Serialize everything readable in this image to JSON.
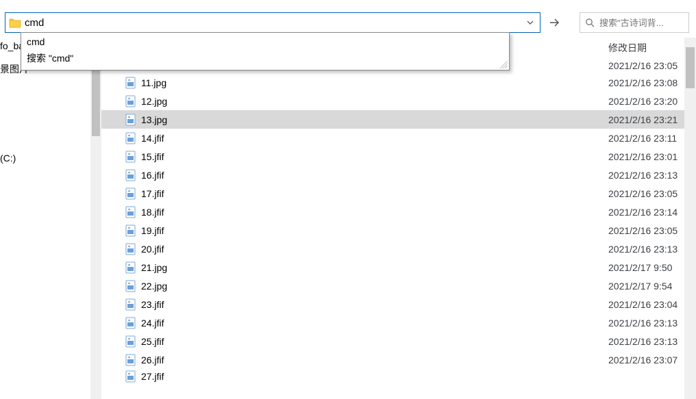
{
  "address": {
    "value": "cmd"
  },
  "dropdown": {
    "items": [
      "cmd",
      "搜索 \"cmd\""
    ]
  },
  "search": {
    "placeholder": "搜索\"古诗词背..."
  },
  "columns": {
    "date": "修改日期"
  },
  "left_nav": {
    "items": [
      "fo_bak",
      "",
      "景图片",
      "",
      "",
      "",
      "",
      "",
      "",
      "",
      "",
      "",
      "",
      "",
      "",
      "",
      "(C:)"
    ]
  },
  "files": [
    {
      "name": "11.jpg",
      "date": "2021/2/16 23:08",
      "selected": false,
      "clipped": false,
      "above_date": "2021/2/16 23:05"
    },
    {
      "name": "12.jpg",
      "date": "2021/2/16 23:20",
      "selected": false,
      "clipped": false
    },
    {
      "name": "13.jpg",
      "date": "2021/2/16 23:21",
      "selected": true,
      "clipped": false
    },
    {
      "name": "14.jfif",
      "date": "2021/2/16 23:11",
      "selected": false,
      "clipped": false
    },
    {
      "name": "15.jfif",
      "date": "2021/2/16 23:01",
      "selected": false,
      "clipped": false
    },
    {
      "name": "16.jfif",
      "date": "2021/2/16 23:13",
      "selected": false,
      "clipped": false
    },
    {
      "name": "17.jfif",
      "date": "2021/2/16 23:05",
      "selected": false,
      "clipped": false
    },
    {
      "name": "18.jfif",
      "date": "2021/2/16 23:14",
      "selected": false,
      "clipped": false
    },
    {
      "name": "19.jfif",
      "date": "2021/2/16 23:05",
      "selected": false,
      "clipped": false
    },
    {
      "name": "20.jfif",
      "date": "2021/2/16 23:13",
      "selected": false,
      "clipped": false
    },
    {
      "name": "21.jpg",
      "date": "2021/2/17 9:50",
      "selected": false,
      "clipped": false
    },
    {
      "name": "22.jpg",
      "date": "2021/2/17 9:54",
      "selected": false,
      "clipped": false
    },
    {
      "name": "23.jfif",
      "date": "2021/2/16 23:04",
      "selected": false,
      "clipped": false
    },
    {
      "name": "24.jfif",
      "date": "2021/2/16 23:13",
      "selected": false,
      "clipped": false
    },
    {
      "name": "25.jfif",
      "date": "2021/2/16 23:13",
      "selected": false,
      "clipped": false
    },
    {
      "name": "26.jfif",
      "date": "2021/2/16 23:07",
      "selected": false,
      "clipped": false
    },
    {
      "name": "27.jfif",
      "date": "",
      "selected": false,
      "clipped": true
    }
  ]
}
